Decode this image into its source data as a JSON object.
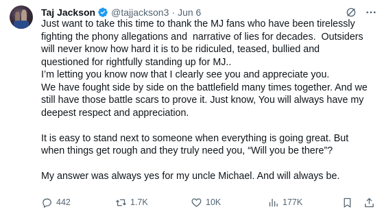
{
  "author": {
    "name": "Taj Jackson",
    "handle": "@tajjackson3",
    "separator": "·",
    "date": "Jun 6"
  },
  "body": {
    "lines": [
      "Just want to take this time to thank the MJ fans who have been tirelessly",
      "fighting the phony allegations and  narrative of lies for decades.  Outsiders",
      "will never know how hard it is to be ridiculed, teased, bullied and",
      "questioned for rightfully standing up for MJ..",
      "I’m letting you know now that I clearly see you and appreciate you.",
      "We have fought side by side on the battlefield many times together. And we",
      "still have those battle scars to prove it. Just know, You will always have my",
      "deepest respect and appreciation.",
      "",
      "It is easy to stand next to someone when everything is going great. But",
      "when things get rough and they truly need you, “Will you be there”?",
      "",
      "My answer was always yes for my uncle Michael. And will always be."
    ]
  },
  "actions": {
    "replies": "442",
    "reposts": "1.7K",
    "likes": "10K",
    "views": "177K"
  },
  "colors": {
    "text": "#0f1419",
    "muted": "#536471",
    "verified": "#1d9bf0"
  }
}
